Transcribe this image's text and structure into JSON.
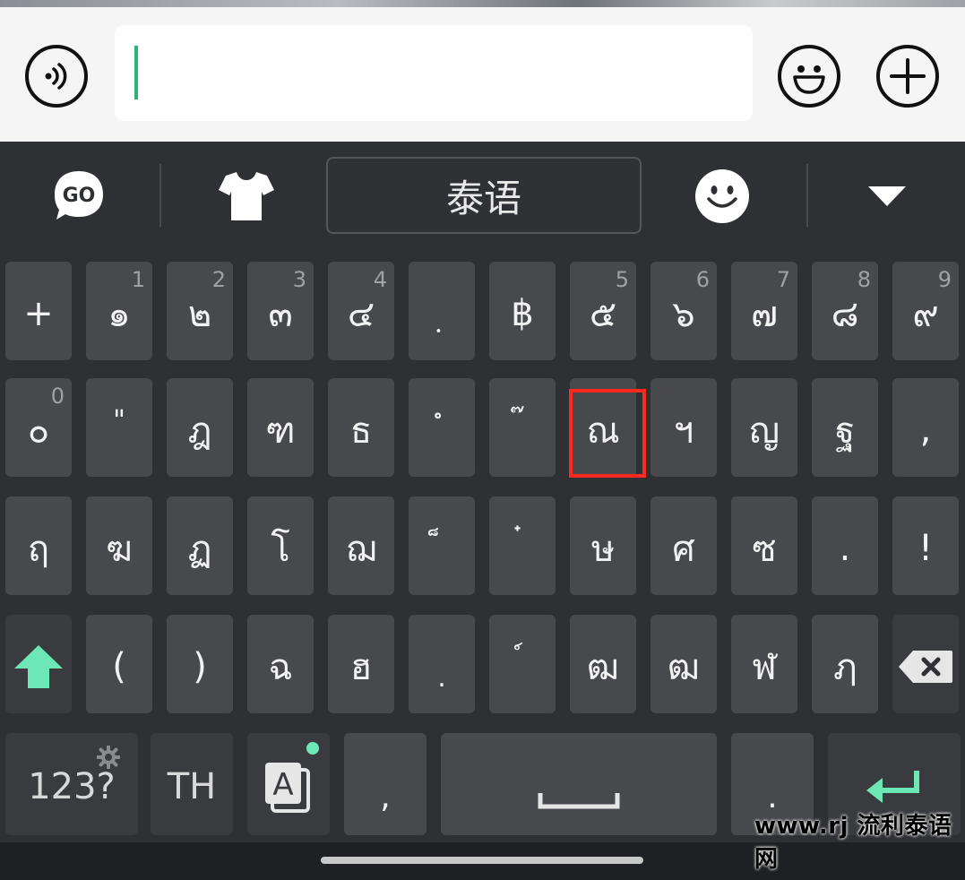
{
  "toolbar": {
    "language_label": "泰语"
  },
  "colors": {
    "accent": "#6ee7b7",
    "caret": "#2bb673",
    "highlight": "#ff2a1f",
    "keyboard_bg": "#2f3034",
    "key_bg": "#48494d"
  },
  "keys": {
    "row1": [
      {
        "main": "+",
        "sub": ""
      },
      {
        "main": "๑",
        "sub": "1"
      },
      {
        "main": "๒",
        "sub": "2"
      },
      {
        "main": "๓",
        "sub": "3"
      },
      {
        "main": "๔",
        "sub": "4"
      },
      {
        "main": "ฺ",
        "sub": ""
      },
      {
        "main": "฿",
        "sub": ""
      },
      {
        "main": "๕",
        "sub": "5"
      },
      {
        "main": "๖",
        "sub": "6"
      },
      {
        "main": "๗",
        "sub": "7"
      },
      {
        "main": "๘",
        "sub": "8"
      },
      {
        "main": "๙",
        "sub": "9"
      }
    ],
    "row2": [
      {
        "main": "๐",
        "sub": "0"
      },
      {
        "main": "\"",
        "sub": ""
      },
      {
        "main": "ฎ",
        "sub": ""
      },
      {
        "main": "ฑ",
        "sub": ""
      },
      {
        "main": "ธ",
        "sub": ""
      },
      {
        "main": "ํ",
        "sub": ""
      },
      {
        "main": "๊",
        "sub": ""
      },
      {
        "main": "ณ",
        "sub": ""
      },
      {
        "main": "ฯ",
        "sub": ""
      },
      {
        "main": "ญ",
        "sub": ""
      },
      {
        "main": "ฐ",
        "sub": ""
      },
      {
        "main": ",",
        "sub": ""
      }
    ],
    "row3": [
      {
        "main": "ฤ"
      },
      {
        "main": "ฆ"
      },
      {
        "main": "ฏ"
      },
      {
        "main": "โ"
      },
      {
        "main": "ฌ"
      },
      {
        "main": "็"
      },
      {
        "main": "๋"
      },
      {
        "main": "ษ"
      },
      {
        "main": "ศ"
      },
      {
        "main": "ซ"
      },
      {
        "main": "."
      },
      {
        "main": "!"
      }
    ],
    "row4": [
      {
        "main": "("
      },
      {
        "main": ")"
      },
      {
        "main": "ฉ"
      },
      {
        "main": "ฮ"
      },
      {
        "main": "."
      },
      {
        "main": "์"
      },
      {
        "main": "ฒ"
      },
      {
        "main": "ฬ"
      },
      {
        "main": "ฦ"
      },
      {
        "main": "ฦ"
      }
    ],
    "bottom": {
      "symbols": "123?",
      "lang": "TH",
      "comma": ",",
      "period": "."
    }
  },
  "row4_display": [
    "(",
    ")",
    "ฉ",
    "ฮ",
    ".",
    "์",
    "ฒ",
    "ฒ",
    "ฬ",
    "ฦ"
  ],
  "row4_fixed": [
    "(",
    ")",
    "ฉ",
    "ฮ",
    ".",
    "ั",
    "ฒ",
    "ฒ",
    "ฬ",
    "ฦ"
  ],
  "watermark": "www.rj 流利泰语网"
}
